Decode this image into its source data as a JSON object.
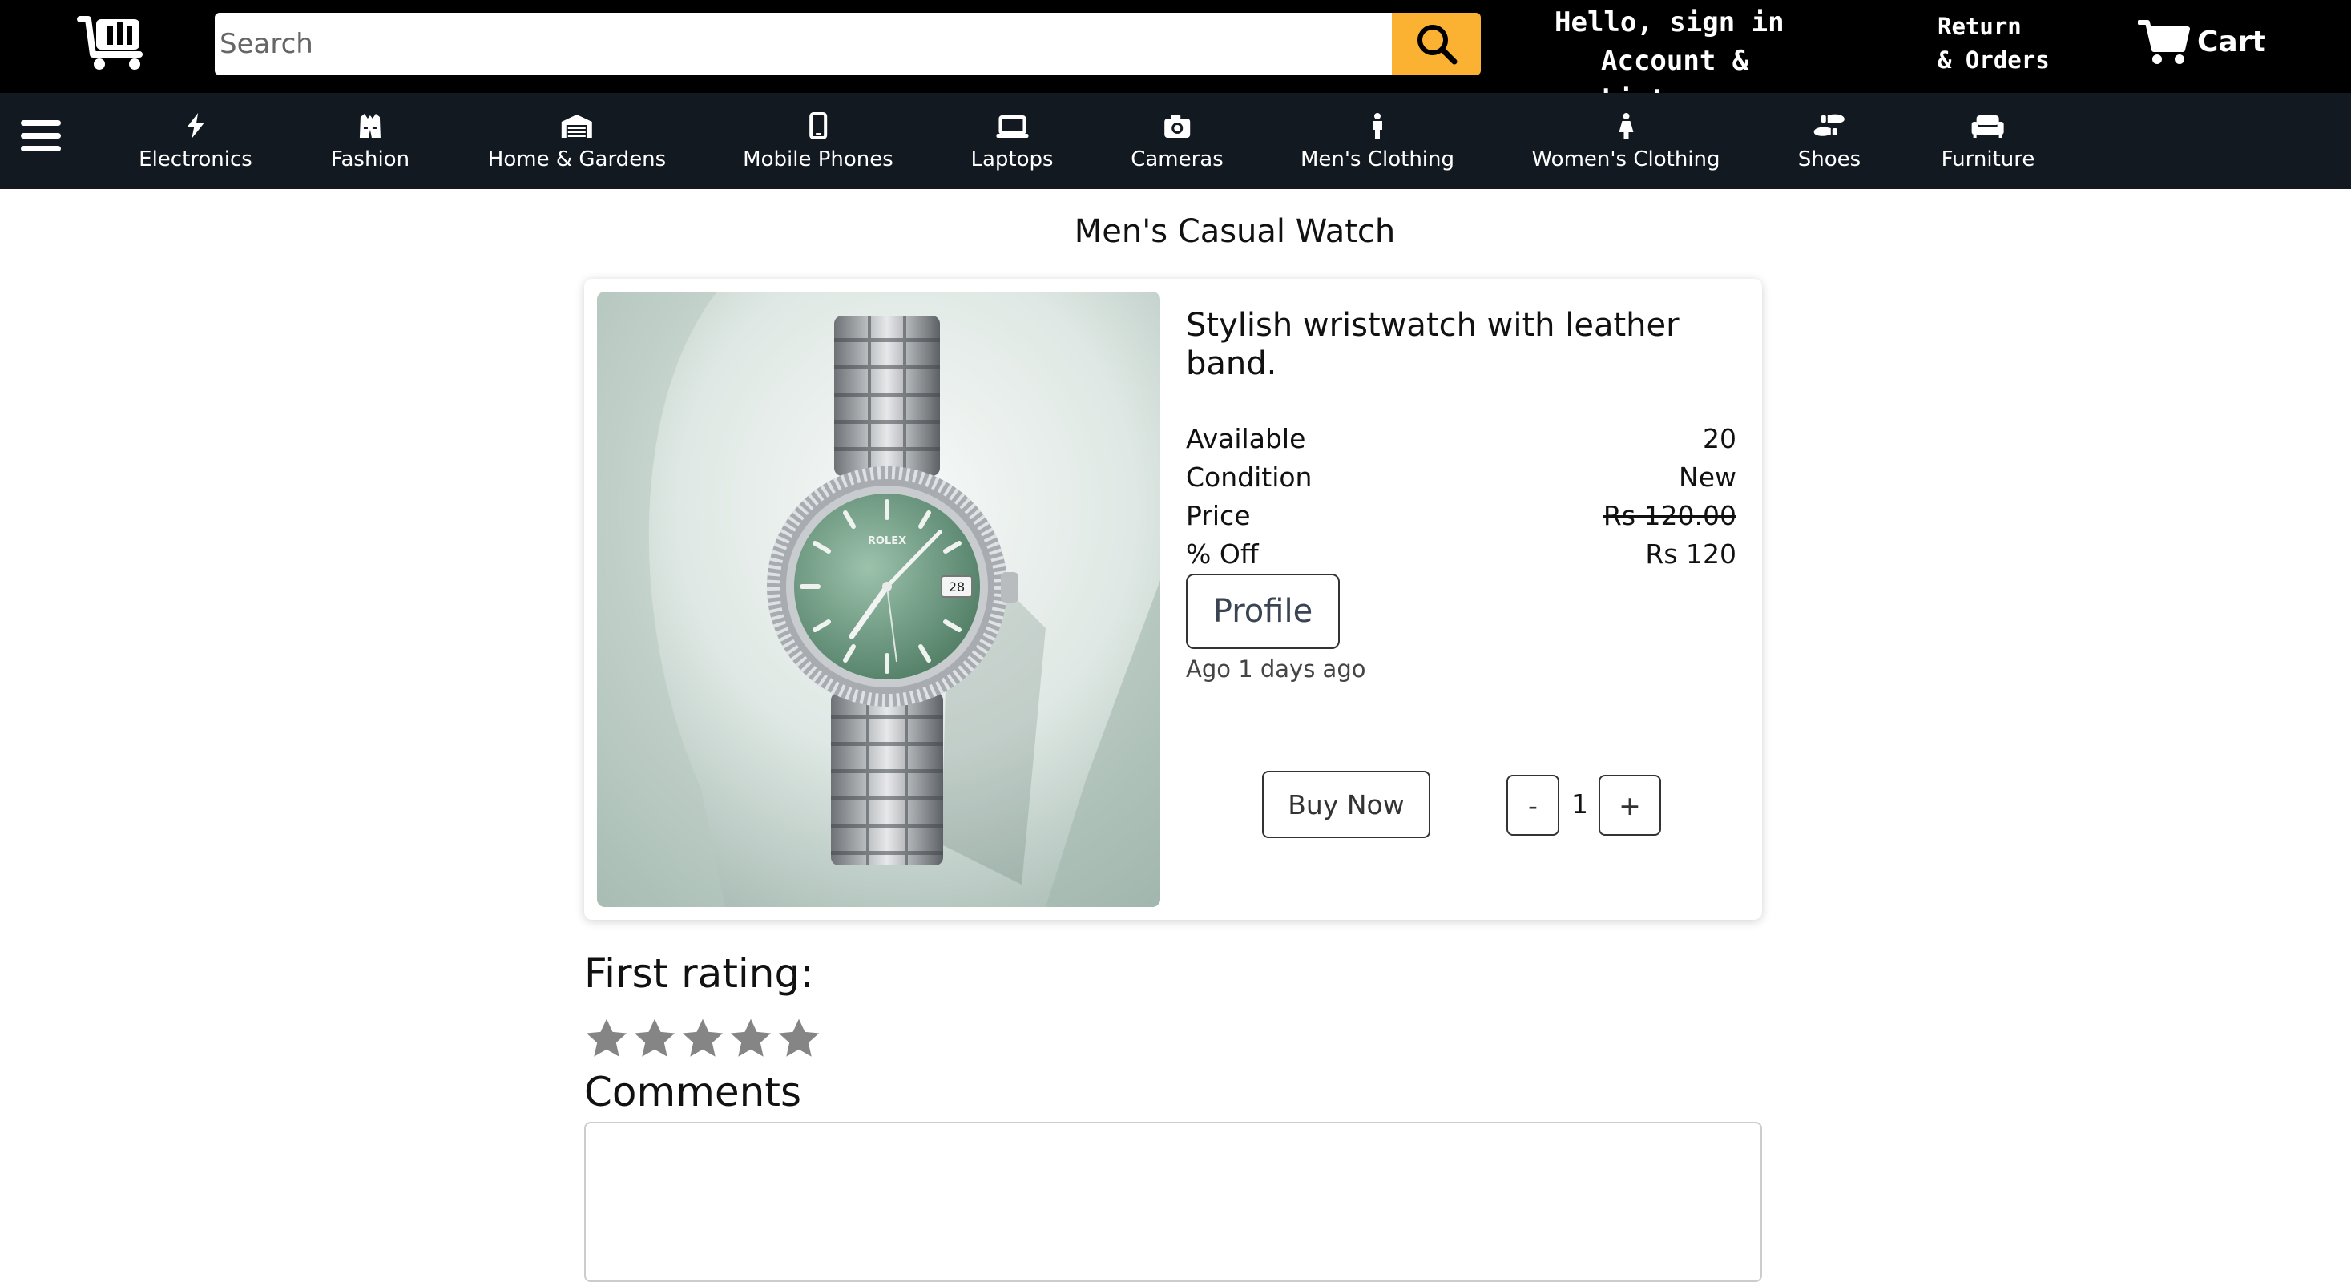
{
  "header": {
    "search": {
      "placeholder": "Search",
      "value": ""
    },
    "account": {
      "line1": "Hello, sign in",
      "line2": "Account & Lists"
    },
    "orders": {
      "line1": "Return",
      "line2": "& Orders"
    },
    "cart_label": "Cart",
    "colors": {
      "bar": "#000000",
      "search_button": "#fbb131"
    }
  },
  "categories": [
    {
      "label": "Electronics",
      "icon": "bolt-icon"
    },
    {
      "label": "Fashion",
      "icon": "vest-icon"
    },
    {
      "label": "Home & Gardens",
      "icon": "warehouse-icon"
    },
    {
      "label": "Mobile Phones",
      "icon": "mobile-icon"
    },
    {
      "label": "Laptops",
      "icon": "laptop-icon"
    },
    {
      "label": "Cameras",
      "icon": "camera-icon"
    },
    {
      "label": "Men's Clothing",
      "icon": "person-icon"
    },
    {
      "label": "Women's Clothing",
      "icon": "person-dress-icon"
    },
    {
      "label": "Shoes",
      "icon": "shoe-prints-icon"
    },
    {
      "label": "Furniture",
      "icon": "couch-icon"
    }
  ],
  "product": {
    "title": "Men's Casual Watch",
    "description": "Stylish wristwatch with leather band.",
    "specs": [
      {
        "label": "Available",
        "value": "20"
      },
      {
        "label": "Condition",
        "value": "New"
      },
      {
        "label": "Price",
        "value": "Rs 120.00"
      },
      {
        "label": "% Off",
        "value": "Rs 120"
      }
    ],
    "profile_label": "Profile",
    "posted": "Ago 1 days ago",
    "buy_label": "Buy Now",
    "quantity": {
      "minus": "-",
      "value": "1",
      "plus": "+"
    },
    "image_brand_text": "ROLEX"
  },
  "rating": {
    "title": "First rating:",
    "stars": 5,
    "selected": 0
  },
  "comments": {
    "title": "Comments",
    "value": ""
  }
}
